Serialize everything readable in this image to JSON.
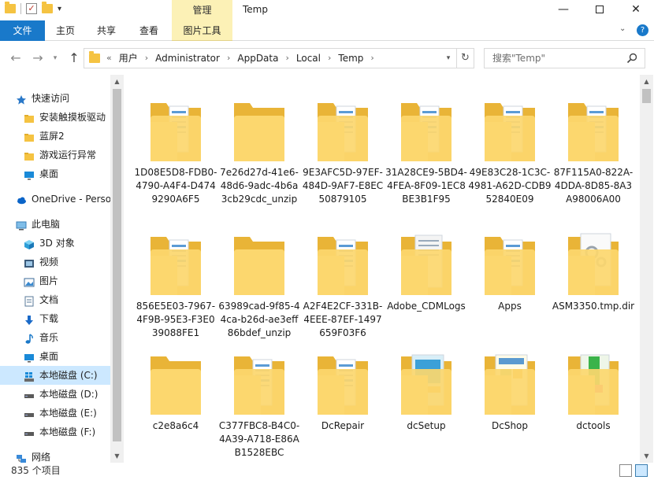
{
  "window": {
    "title": "Temp",
    "context_tab": "管理",
    "minimize_glyph": "—",
    "close_glyph": "✕"
  },
  "ribbon": {
    "tabs": [
      "文件",
      "主页",
      "共享",
      "查看",
      "图片工具"
    ]
  },
  "address": {
    "overflow": "«",
    "crumbs": [
      "用户",
      "Administrator",
      "AppData",
      "Local",
      "Temp"
    ],
    "search_placeholder": "搜索\"Temp\""
  },
  "sidebar": {
    "items": [
      {
        "label": "快速访问",
        "icon": "star-icon"
      },
      {
        "label": "安装触摸板驱动",
        "icon": "folder-icon"
      },
      {
        "label": "蓝屏2",
        "icon": "folder-icon"
      },
      {
        "label": "游戏运行异常",
        "icon": "folder-icon"
      },
      {
        "label": "桌面",
        "icon": "desktop-icon"
      },
      {
        "label": "OneDrive - Perso",
        "icon": "cloud-icon"
      },
      {
        "label": "此电脑",
        "icon": "computer-icon"
      },
      {
        "label": "3D 对象",
        "icon": "cube-icon"
      },
      {
        "label": "视频",
        "icon": "video-icon"
      },
      {
        "label": "图片",
        "icon": "picture-icon"
      },
      {
        "label": "文档",
        "icon": "document-icon"
      },
      {
        "label": "下载",
        "icon": "download-icon"
      },
      {
        "label": "音乐",
        "icon": "music-icon"
      },
      {
        "label": "桌面",
        "icon": "desktop-icon"
      },
      {
        "label": "本地磁盘 (C:)",
        "icon": "windows-drive-icon"
      },
      {
        "label": "本地磁盘 (D:)",
        "icon": "drive-icon"
      },
      {
        "label": "本地磁盘 (E:)",
        "icon": "drive-icon"
      },
      {
        "label": "本地磁盘 (F:)",
        "icon": "drive-icon"
      },
      {
        "label": "网络",
        "icon": "network-icon"
      }
    ],
    "selected_index": 14
  },
  "content": {
    "items": [
      {
        "name": "1D08E5D8-FDB0-4790-A4F4-D4749290A6F5",
        "kind": "docs"
      },
      {
        "name": "7e26d27d-41e6-48d6-9adc-4b6a3cb29cdc_unzip",
        "kind": "empty"
      },
      {
        "name": "9E3AFC5D-97EF-484D-9AF7-E8EC50879105",
        "kind": "docs"
      },
      {
        "name": "31A28CE9-5BD4-4FEA-8F09-1EC8BE3B1F95",
        "kind": "docs"
      },
      {
        "name": "49E83C28-1C3C-4981-A62D-CDB952840E09",
        "kind": "docs"
      },
      {
        "name": "87F115A0-822A-4DDA-8D85-8A3A98006A00",
        "kind": "docs"
      },
      {
        "name": "856E5E03-7967-4F9B-95E3-F3E039088FE1",
        "kind": "docs"
      },
      {
        "name": "63989cad-9f85-44ca-b26d-ae3eff86bdef_unzip",
        "kind": "empty"
      },
      {
        "name": "A2F4E2CF-331B-4EEE-87EF-1497659F03F6",
        "kind": "docs"
      },
      {
        "name": "Adobe_CDMLogs",
        "kind": "pages"
      },
      {
        "name": "Apps",
        "kind": "docs"
      },
      {
        "name": "ASM3350.tmp.dir",
        "kind": "gears"
      },
      {
        "name": "c2e8a6c4",
        "kind": "empty"
      },
      {
        "name": "C377FBC8-B4C0-4A39-A718-E86AB1528EBC",
        "kind": "docs"
      },
      {
        "name": "DcRepair",
        "kind": "docs"
      },
      {
        "name": "dcSetup",
        "kind": "setup"
      },
      {
        "name": "DcShop",
        "kind": "shop"
      },
      {
        "name": "dctools",
        "kind": "tools"
      }
    ]
  },
  "status": {
    "count_text": "835 个项目"
  },
  "colors": {
    "folder_back": "#e9b437",
    "folder_front": "#fcd76e",
    "file_tab": "#1979ca",
    "context_tab": "#fcf1b6",
    "selection": "#cce8ff"
  }
}
